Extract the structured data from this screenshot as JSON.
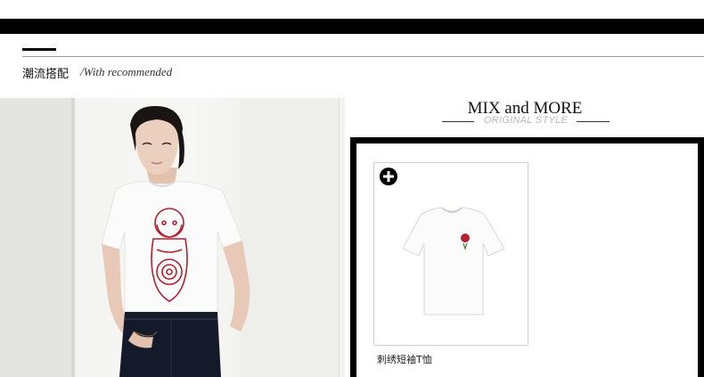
{
  "section": {
    "title": "潮流搭配",
    "subtitle": "/With recommended"
  },
  "mix": {
    "title": "MIX and MORE",
    "subtitle": "ORIGINAL STYLE"
  },
  "product": {
    "name": "刺绣短袖T恤",
    "add_icon": "plus-circle-icon"
  },
  "colors": {
    "bar": "#000000",
    "shirt": "#ffffff",
    "embroidery": "#b3202f",
    "jeans": "#141a2a"
  }
}
